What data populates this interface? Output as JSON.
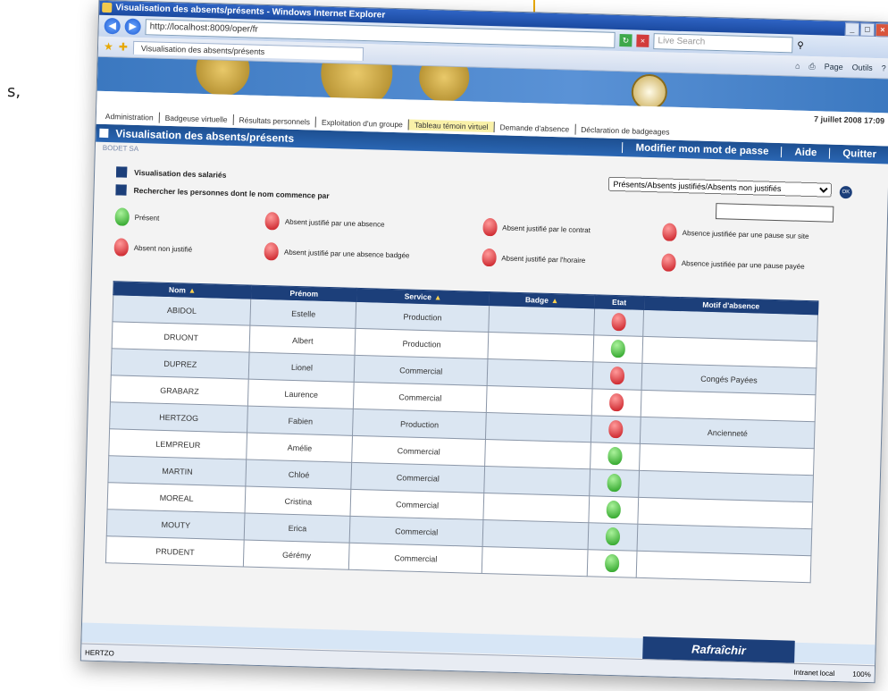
{
  "fragment_text": "s,",
  "browser": {
    "title": "Visualisation des absents/présents - Windows Internet Explorer",
    "url": "http://localhost:8009/oper/fr",
    "search_placeholder": "Live Search",
    "tab_label": "Visualisation des absents/présents",
    "tools": [
      "Page",
      "Outils"
    ]
  },
  "app": {
    "datetime": "7 juillet 2008 17:09",
    "menu": [
      {
        "label": "Administration",
        "active": false
      },
      {
        "label": "Badgeuse virtuelle",
        "active": false
      },
      {
        "label": "Résultats personnels",
        "active": false
      },
      {
        "label": "Exploitation d'un groupe",
        "active": false
      },
      {
        "label": "Tableau témoin virtuel",
        "active": true
      },
      {
        "label": "Demande d'absence",
        "active": false
      },
      {
        "label": "Déclaration de badgeages",
        "active": false
      }
    ],
    "page_title": "Visualisation des absents/présents",
    "header_links": [
      "Modifier mon mot de passe",
      "Aide",
      "Quitter"
    ],
    "breadcrumb": "BODET SA",
    "options": [
      "Visualisation des salariés",
      "Rechercher les personnes dont le nom commence par"
    ],
    "filter_value": "Présents/Absents justifiés/Absents non justifiés",
    "ok_label": "OK",
    "legend": [
      {
        "label": "Présent",
        "color": "green"
      },
      {
        "label": "Absent justifié par une absence",
        "color": "red"
      },
      {
        "label": "Absent justifié par le contrat",
        "color": "red"
      },
      {
        "label": "Absence justifiée par une pause sur site",
        "color": "red"
      },
      {
        "label": "Absent non justifié",
        "color": "red"
      },
      {
        "label": "Absent justifié par une absence badgée",
        "color": "red"
      },
      {
        "label": "Absent justifié par l'horaire",
        "color": "red"
      },
      {
        "label": "Absence justifiée par une pause payée",
        "color": "red"
      }
    ],
    "table": {
      "headers": [
        "Nom",
        "Prénom",
        "Service",
        "Badge",
        "Etat",
        "Motif d'absence"
      ],
      "rows": [
        {
          "nom": "ABIDOL",
          "prenom": "Estelle",
          "service": "Production",
          "badge": "",
          "etat": "red",
          "motif": ""
        },
        {
          "nom": "DRUONT",
          "prenom": "Albert",
          "service": "Production",
          "badge": "",
          "etat": "green",
          "motif": ""
        },
        {
          "nom": "DUPREZ",
          "prenom": "Lionel",
          "service": "Commercial",
          "badge": "",
          "etat": "red",
          "motif": "Congés Payées"
        },
        {
          "nom": "GRABARZ",
          "prenom": "Laurence",
          "service": "Commercial",
          "badge": "",
          "etat": "red",
          "motif": ""
        },
        {
          "nom": "HERTZOG",
          "prenom": "Fabien",
          "service": "Production",
          "badge": "",
          "etat": "red",
          "motif": "Ancienneté"
        },
        {
          "nom": "LEMPREUR",
          "prenom": "Amélie",
          "service": "Commercial",
          "badge": "",
          "etat": "green",
          "motif": ""
        },
        {
          "nom": "MARTIN",
          "prenom": "Chloé",
          "service": "Commercial",
          "badge": "",
          "etat": "green",
          "motif": ""
        },
        {
          "nom": "MOREAL",
          "prenom": "Cristina",
          "service": "Commercial",
          "badge": "",
          "etat": "green",
          "motif": ""
        },
        {
          "nom": "MOUTY",
          "prenom": "Erica",
          "service": "Commercial",
          "badge": "",
          "etat": "green",
          "motif": ""
        },
        {
          "nom": "PRUDENT",
          "prenom": "Gérémy",
          "service": "Commercial",
          "badge": "",
          "etat": "green",
          "motif": ""
        }
      ]
    },
    "refresh_label": "Rafraîchir",
    "status_left": "HERTZO",
    "status_zone": "Intranet local",
    "status_zoom": "100%"
  },
  "colors": {
    "header_blue": "#1c3f7a",
    "active_menu": "#f9f1a8",
    "row_alt": "#dbe6f2"
  }
}
